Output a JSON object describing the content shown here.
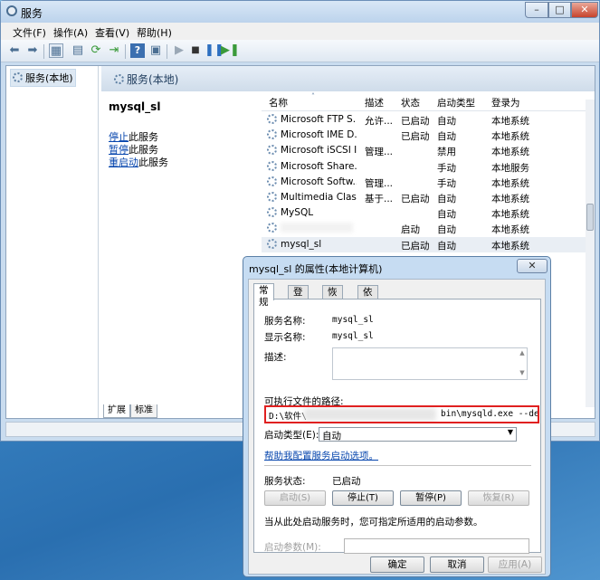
{
  "window": {
    "title": "服务",
    "min": "–",
    "max": "□",
    "close": "✕"
  },
  "menu": [
    "文件(F)",
    "操作(A)",
    "查看(V)",
    "帮助(H)"
  ],
  "toolbar_icons": [
    "back-icon",
    "forward-icon",
    "console-tree-icon",
    "properties-icon",
    "refresh-icon",
    "export-icon",
    "help-icon",
    "show-hide-icon",
    "play-icon",
    "stop-icon",
    "pause-icon",
    "restart-icon"
  ],
  "tree": {
    "root": "服务(本地)"
  },
  "header": {
    "title": "服务(本地)"
  },
  "detail": {
    "name": "mysql_sl",
    "link1": "停止",
    "text1": "此服务",
    "link2": "暂停",
    "text2": "此服务",
    "link3": "重启动",
    "text3": "此服务"
  },
  "bottom_tabs": [
    "扩展",
    "标准"
  ],
  "list": {
    "columns": [
      "名称",
      "描述",
      "状态",
      "启动类型",
      "登录为"
    ],
    "rows": [
      {
        "name": "Microsoft FTP S...",
        "desc": "允许...",
        "status": "已启动",
        "startup": "自动",
        "logon": "本地系统"
      },
      {
        "name": "Microsoft IME D...",
        "desc": "",
        "status": "已启动",
        "startup": "自动",
        "logon": "本地系统"
      },
      {
        "name": "Microsoft iSCSI I...",
        "desc": "管理...",
        "status": "",
        "startup": "禁用",
        "logon": "本地系统"
      },
      {
        "name": "Microsoft Share...",
        "desc": "",
        "status": "",
        "startup": "手动",
        "logon": "本地服务"
      },
      {
        "name": "Microsoft Softw...",
        "desc": "管理...",
        "status": "",
        "startup": "手动",
        "logon": "本地系统"
      },
      {
        "name": "Multimedia Clas...",
        "desc": "基于...",
        "status": "已启动",
        "startup": "自动",
        "logon": "本地系统"
      },
      {
        "name": "MySQL",
        "desc": "",
        "status": "",
        "startup": "自动",
        "logon": "本地系统"
      },
      {
        "name": "",
        "desc": "",
        "status": "启动",
        "startup": "自动",
        "logon": "本地系统"
      },
      {
        "name": "mysql_sl",
        "desc": "",
        "status": "已启动",
        "startup": "自动",
        "logon": "本地系统"
      }
    ]
  },
  "dialog": {
    "title": "mysql_sl 的属性(本地计算机)",
    "close": "✕",
    "tabs": [
      "常规",
      "登录",
      "恢复",
      "依存关系"
    ],
    "service_name_label": "服务名称:",
    "service_name": "mysql_sl",
    "display_name_label": "显示名称:",
    "display_name": "mysql_sl",
    "desc_label": "描述:",
    "path_label": "可执行文件的路径:",
    "path_start": "D:\\软件\\",
    "path_end": "bin\\mysqld.exe --defaul",
    "startup_label": "启动类型(E):",
    "startup_value": "自动",
    "help_link": "帮助我配置服务启动选项。",
    "status_label": "服务状态:",
    "status_value": "已启动",
    "btn_start": "启动(S)",
    "btn_stop": "停止(T)",
    "btn_pause": "暂停(P)",
    "btn_resume": "恢复(R)",
    "hint": "当从此处启动服务时，您可指定所适用的启动参数。",
    "params_label": "启动参数(M):",
    "ok": "确定",
    "cancel": "取消",
    "apply": "应用(A)"
  }
}
